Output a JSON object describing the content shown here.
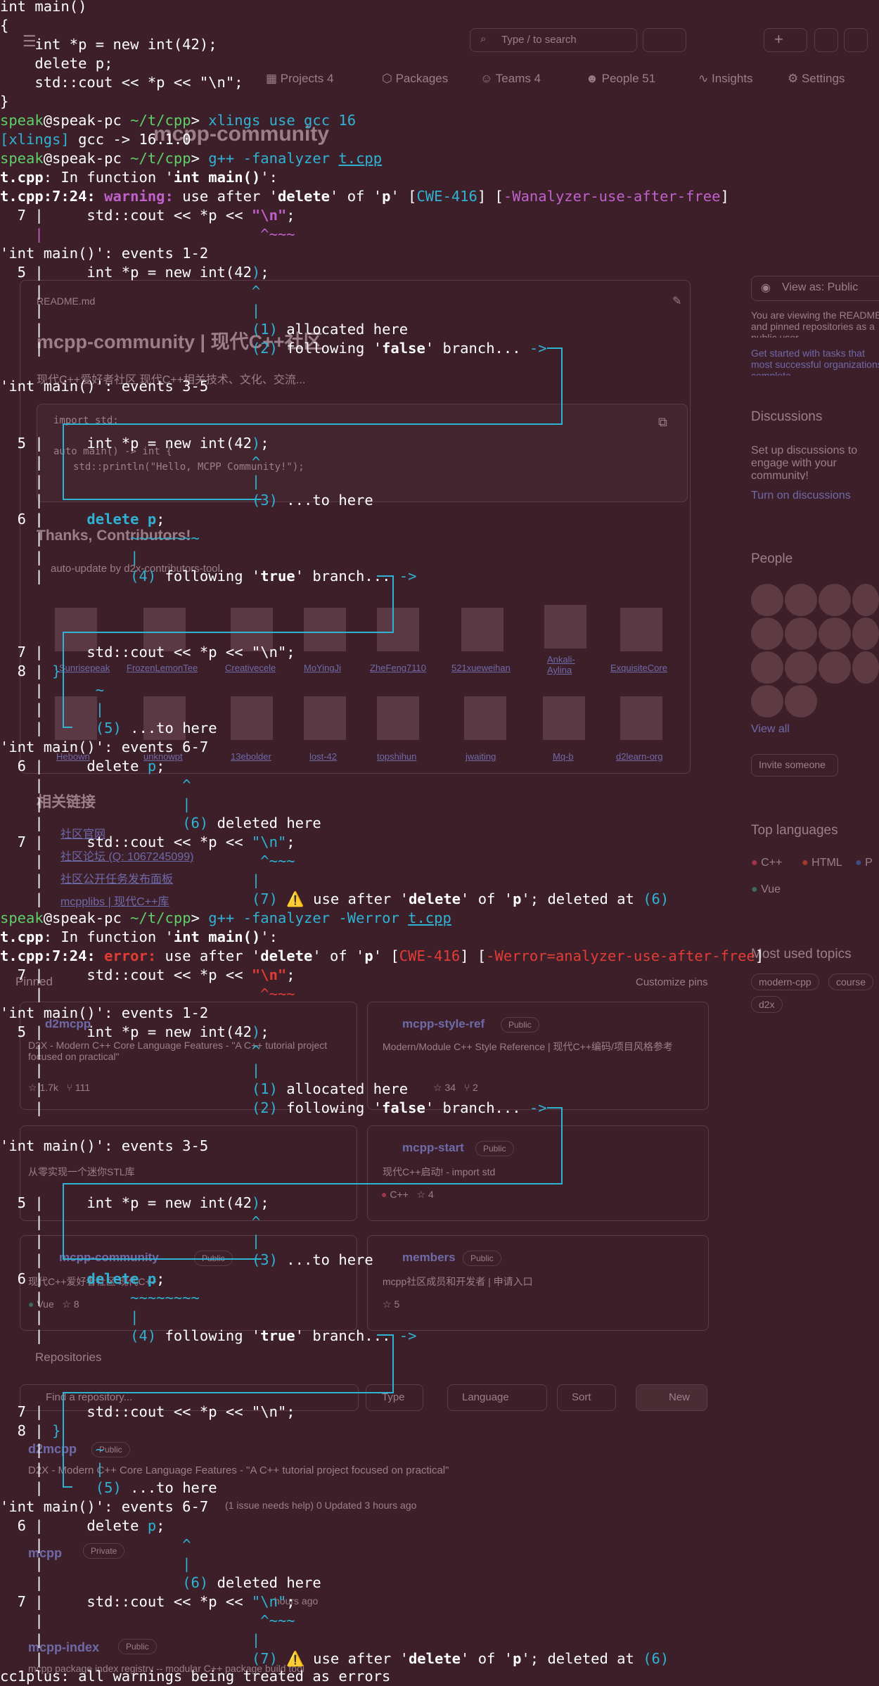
{
  "background_page": {
    "org_title": "mcpp-community",
    "nav_tabs": [
      {
        "label": "Projects",
        "count": "4"
      },
      {
        "label": "Packages",
        "count": ""
      },
      {
        "label": "Teams",
        "count": "4"
      },
      {
        "label": "People",
        "count": "51"
      },
      {
        "label": "Insights",
        "count": ""
      },
      {
        "label": "Settings",
        "count": ""
      }
    ],
    "search_placeholder": "Type / to search",
    "readme_file": "README.md",
    "readme_heading": "mcpp-community | 现代C++社区",
    "readme_intro": "现代C++爱好者社区 现代C++相关技术、文化、交流...",
    "code_lines": [
      "import std;",
      "auto main() -> int {",
      "std::println(\"Hello, MCPP Community!\");"
    ],
    "thanks_heading": "Thanks, Contributors!",
    "auto_update_note": "auto-update by d2x-contributors-tool",
    "contributors_row1": [
      "Sunrisepeak",
      "FrozenLemonTee",
      "Creativecele",
      "MoYingJi",
      "ZheFeng7110",
      "521xueweihan",
      "Ankali-Aylina",
      "ExquisiteCore"
    ],
    "contributors_row2": [
      "Hebown",
      "unknowpt",
      "13ebolder",
      "lost-42",
      "topshihun",
      "jwaiting",
      "Mq-b",
      "d2learn-org"
    ],
    "links_heading": "相关链接",
    "links": [
      "社区官网",
      "社区论坛 (Q: 1067245099)",
      "社区公开任务发布面板",
      "mcpplibs | 现代C++库"
    ],
    "view_as": "View as: Public",
    "viewing_note": "You are viewing the README and pinned repositories as a public user.",
    "get_started": "Get started with tasks that most successful organizations complete.",
    "discussions_heading": "Discussions",
    "discussions_text": "Set up discussions to engage with your community!",
    "discussions_link": "Turn on discussions",
    "people_heading": "People",
    "view_all": "View all",
    "invite_button": "Invite someone",
    "top_languages_heading": "Top languages",
    "languages": [
      "C++",
      "HTML",
      "P",
      "Vue"
    ],
    "topics_heading": "Most used topics",
    "topics": [
      "modern-cpp",
      "course",
      "d2x"
    ],
    "pinned_heading": "Pinned",
    "customize_pins": "Customize pins",
    "pinned": [
      {
        "name": "d2mcpp",
        "desc": "D2X - Modern C++ Core Language Features - \"A C++ tutorial project focused on practical\"",
        "stars": "1.7k",
        "forks": "111"
      },
      {
        "name": "mcpp-style-ref",
        "badge": "Public",
        "desc": "Modern/Module C++ Style Reference | 现代C++编码/项目风格参考",
        "stars": "34",
        "forks": "2"
      },
      {
        "name": "",
        "desc": "从零实现一个迷你STL库",
        "stars": "",
        "forks": ""
      },
      {
        "name": "mcpp-start",
        "badge": "Public",
        "desc": "现代C++启动! - import std",
        "lang": "C++",
        "stars": "4"
      },
      {
        "name": "mcpp-community",
        "badge": "Public",
        "desc": "现代C++爱好者社区 现代C++",
        "lang": "Vue",
        "stars": "8"
      },
      {
        "name": "members",
        "badge": "Public",
        "desc": "mcpp社区成员和开发者 | 申请入口",
        "stars": "5"
      }
    ],
    "repos_heading": "Repositories",
    "find_repo_placeholder": "Find a repository...",
    "filters": [
      "Type",
      "Language",
      "Sort"
    ],
    "new_button": "New",
    "repos": [
      {
        "name": "d2mcpp",
        "badge": "Public",
        "desc": "D2X - Modern C++ Core Language Features - \"A C++ tutorial project focused on practical\"",
        "meta": "(1 issue needs help)   0   Updated 3 hours ago"
      },
      {
        "name": "mcpp",
        "badge": "Private",
        "desc": "",
        "meta": "hours ago"
      },
      {
        "name": "mcpp-index",
        "badge": "Public",
        "desc": "mcpp package index registry -- modular C++ package build tool",
        "meta": ""
      }
    ]
  },
  "terminal": {
    "source_lines": [
      "int main()",
      "{",
      "    int *p = new int(42);",
      "    delete p;",
      "    std::cout << *p << \"\\n\";",
      "}"
    ],
    "prompt_user": "speak",
    "prompt_host": "@speak-pc",
    "prompt_path": "~/t/cpp",
    "prompt_sym": ">",
    "cmd1": {
      "prog": "xlings",
      "args": " use gcc 16"
    },
    "out1_tag": "[xlings]",
    "out1_text": " gcc -> 16.1.0",
    "cmd2": {
      "prog": "g++",
      "args": " -fanalyzer ",
      "file": "t.cpp"
    },
    "cmd3": {
      "prog": "g++",
      "args": " -fanalyzer -Werror ",
      "file": "t.cpp"
    },
    "in_function_pre": ": In function '",
    "in_function_name": "int main()",
    "in_function_post": "':",
    "diag_file": "t.cpp",
    "diag_loc": "t.cpp:7:24:",
    "warning_kw": "warning:",
    "error_kw": "error:",
    "diag_msg1": " use after '",
    "diag_msg2": "' of '",
    "diag_msg3": "' [",
    "diag_delete": "delete",
    "diag_var": "p",
    "cwe": "CWE-416",
    "flag_warn": "-Wanalyzer-use-after-free",
    "flag_err": "-Werror=analyzer-use-after-free",
    "ln7_code_pre": "  7 |     std::cout << *p << ",
    "ln7_str": "\"\\n\"",
    "ln7_tail": ";",
    "carets4": "                         ^~~~",
    "gutter": "    |",
    "events12": "'int main()': events 1-2",
    "events35": "'int main()': events 3-5",
    "events67": "'int main()': events 6-7",
    "ln5_pre": "  5 |     int *p = new int(42",
    "ln5_close": ")",
    "ln5_tail": ";",
    "caret_pos": "                        ^",
    "bar_pos": "                        |",
    "ev1": "(1)",
    "ev1_text": " allocated here",
    "ev2": "(2)",
    "ev2_text_a": " following '",
    "ev2_kw": "false",
    "ev2_text_b": "' branch... ",
    "arrow": "->",
    "ev3": "(3)",
    "ev3_text": " ...to here",
    "ln6_pre": "  6 |     ",
    "ln6_kw": "delete p",
    "ln6_tail": ";",
    "tilde8": "          ~~~~~~~~",
    "bar_pos2": "          |",
    "ev4": "(4)",
    "ev4_text_a": " following '",
    "ev4_kw": "true",
    "ev4_text_b": "' branch... ",
    "ln7_plain": "  7 |     std::cout << *p << \"\\n\";",
    "ln8_pre": "  8 | ",
    "ln8_brace": "}",
    "tilde1": "      ~",
    "bar6": "      |",
    "ev5": "(5)",
    "ev5_text": " ...to here",
    "ln6b_pre": "  6 |     delete ",
    "ln6b_var": "p",
    "ln6b_tail": ";",
    "caret6": "                ^",
    "bar6b": "                |",
    "ev6": "(6)",
    "ev6_text": " deleted here",
    "bar7": "                        |",
    "ev7": "(7)",
    "ev7_warn": "⚠️",
    "ev7_text_a": " use after '",
    "ev7_text_b": "' of '",
    "ev7_text_c": "'; deleted at ",
    "ev7_ref": "(6)",
    "final_line": "cc1plus: all warnings being treated as errors"
  }
}
